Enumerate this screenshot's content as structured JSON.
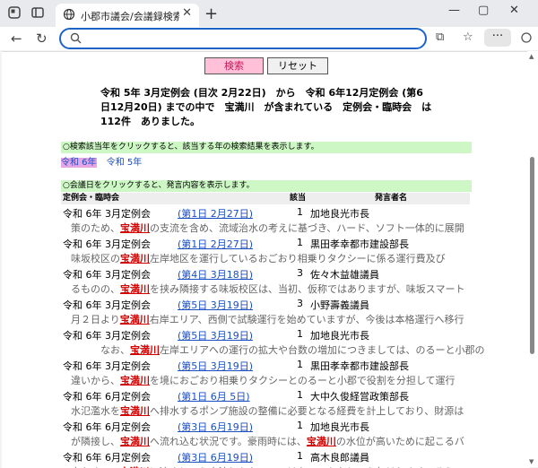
{
  "browser": {
    "tab_title": "小郡市議会/会議録検索システム",
    "tab_close": "✕",
    "new_tab": "+",
    "win_min": "—",
    "win_max": "▢",
    "win_close": "✕",
    "address_value": "",
    "address_placeholder": "",
    "more_label": "···"
  },
  "page": {
    "search_button": "検索",
    "reset_button": "リセット",
    "summary_line1": "令和 5年 3月定例会 (目次 2月22日)　から　令和 6年12月定例会 (第6",
    "summary_line2": "日12月20日) までの中で　宝満川　が含まれている　定例会・臨時会　は",
    "summary_line3": "112件　ありました。",
    "year_hint": "○検索該当年をクリックすると、該当する年の検索結果を表示します。",
    "years": [
      "令和 6年",
      "令和 5年"
    ],
    "day_hint": "○会議日をクリックすると、発言内容を表示します。",
    "col_session": "定例会・臨時会",
    "col_hits": "該当",
    "col_speaker": "発言者名",
    "keyword": "宝満川"
  },
  "rows": [
    {
      "session": "令和 6年 3月定例会",
      "date": "(第1日 2月27日)",
      "hits": "1",
      "speaker": "加地良光市長",
      "pre": "　策のため、",
      "post": "の支流を含め、流域治水の考えに基づき、ハード、ソフト一体的に展開"
    },
    {
      "session": "令和 6年 3月定例会",
      "date": "(第1日 2月27日)",
      "hits": "1",
      "speaker": "黒田孝幸都市建設部長",
      "pre": "　味坂校区の",
      "post": "左岸地区を運行しているおごおり相乗りタクシーに係る運行費及び"
    },
    {
      "session": "令和 6年 3月定例会",
      "date": "(第4日 3月18日)",
      "hits": "3",
      "speaker": "佐々木益雄議員",
      "pre": "　るものの、",
      "post": "を挟み隣接する味坂校区は、当初、仮称ではありますが、味坂スマート"
    },
    {
      "session": "令和 6年 3月定例会",
      "date": "(第5日 3月19日)",
      "hits": "3",
      "speaker": "小野壽義議員",
      "pre": "　月２日より",
      "post": "右岸エリア、西側で試験運行を始めていますが、今後は本格運行へ移行"
    },
    {
      "session": "令和 6年 3月定例会",
      "date": "(第5日 3月19日)",
      "hits": "1",
      "speaker": "加地良光市長",
      "pre": "　　　　なお、",
      "post": "左岸エリアへの運行の拡大や台数の増加につきましては、のるーと小郡の"
    },
    {
      "session": "令和 6年 3月定例会",
      "date": "(第5日 3月19日)",
      "hits": "1",
      "speaker": "黒田孝幸都市建設部長",
      "pre": "　違いから、",
      "post": "を境におごおり相乗りタクシーとのるーと小郡で役割を分担して運行"
    },
    {
      "session": "令和 6年 6月定例会",
      "date": "(第1日 6月 5日)",
      "hits": "1",
      "speaker": "大中久俊経営政策部長",
      "pre": "　水氾濫水を",
      "post": "へ排水するポンプ施設の整備に必要となる経費を計上しており、財源は"
    },
    {
      "session": "令和 6年 6月定例会",
      "date": "(第3日 6月19日)",
      "hits": "1",
      "speaker": "加地良光市長",
      "pre": "　が隣接し、",
      "post": "へ流れ込む状況です。豪雨時には、",
      "post2": "の水位が高いために起こるバ"
    },
    {
      "session": "令和 6年 6月定例会",
      "date": "(第3日 6月19日)",
      "hits": "1",
      "speaker": "高木良郎議員",
      "pre": "　定ためて、",
      "post": "に流すという方法しかないのではないのかなという気はします。そうい"
    }
  ]
}
